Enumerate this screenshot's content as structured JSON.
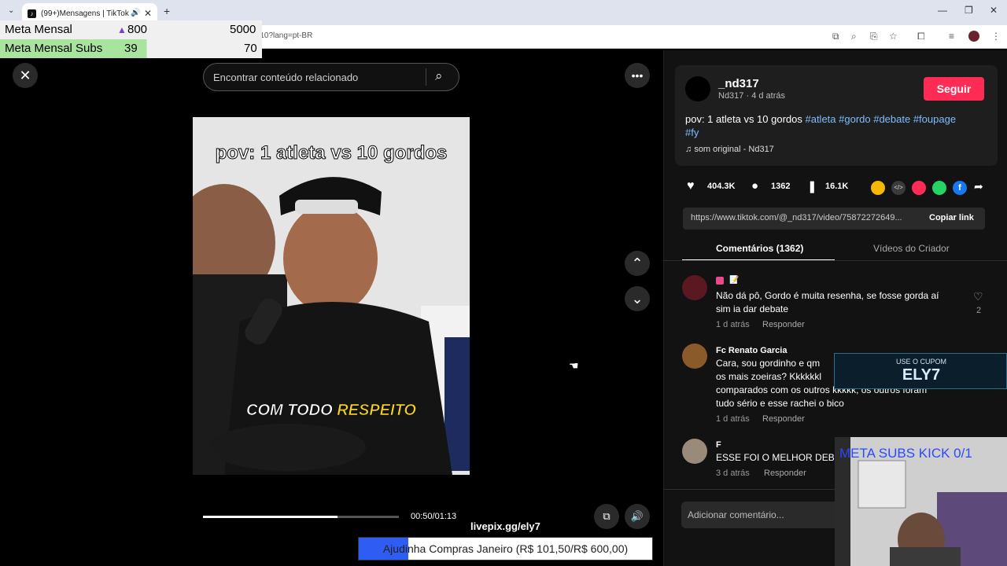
{
  "browser": {
    "tab_title": "(99+)Mensagens | TikTok",
    "url": "tiktok.com/@_nd317/video/7587227264957312210?lang=pt-BR"
  },
  "overlay": {
    "meta_label": "Meta Mensal",
    "meta_current": "800",
    "meta_goal": "5000",
    "meta_subs_label": "Meta Mensal Subs",
    "meta_subs_current": "39",
    "meta_subs_goal": "70",
    "meta_subs_progress": 0.56,
    "livepix": "livepix.gg/ely7",
    "coupon_label": "USE O CUPOM",
    "coupon_code": "ELY7",
    "cam_title": "META SUBS KICK 0/1",
    "donation_text": "Ajudinha Compras Janeiro (R$ 101,50/R$ 600,00)",
    "donation_progress": 0.169
  },
  "player": {
    "search_placeholder": "Encontrar conteúdo relacionado",
    "video_title": "pov: 1 atleta vs 10 gordos",
    "subtitle_a": "COM TODO ",
    "subtitle_b": "RESPEITO",
    "time": "00:50/01:13",
    "progress": 0.685
  },
  "post": {
    "username": "_nd317",
    "sub": "Nd317 · 4 d atrás",
    "follow": "Seguir",
    "desc_text": "pov: 1 atleta vs 10 gordos ",
    "tags": "#atleta #gordo #debate #foupage",
    "tag_fy": "#fy",
    "music": "som original - Nd317",
    "likes": "404.3K",
    "comments": "1362",
    "saves": "16.1K",
    "link": "https://www.tiktok.com/@_nd317/video/75872272649...",
    "copy": "Copiar link",
    "tab_comments": "Comentários (1362)",
    "tab_creator": "Vídeos do Criador",
    "add_comment": "Adicionar comentário..."
  },
  "comments": [
    {
      "name": "",
      "text1": "Não dá pô, Gordo é muita resenha, se fosse gorda aí",
      "text2": "sim ia dar debate",
      "time": "1 d atrás",
      "reply": "Responder",
      "likes": "2"
    },
    {
      "name": "Fc Renato Garcia",
      "text1": "Cara, sou gordinho e qm",
      "text2": "os mais zoeiras? Kkkkkkl",
      "text3": "comparados com os outros kkkkk, os outros foram",
      "text4": "tudo sério e esse rachei o bico",
      "time": "1 d atrás",
      "reply": "Responder"
    },
    {
      "name": "F",
      "text1": "ESSE FOI O MELHOR DEB",
      "time": "3 d atrás",
      "reply": "Responder"
    }
  ]
}
